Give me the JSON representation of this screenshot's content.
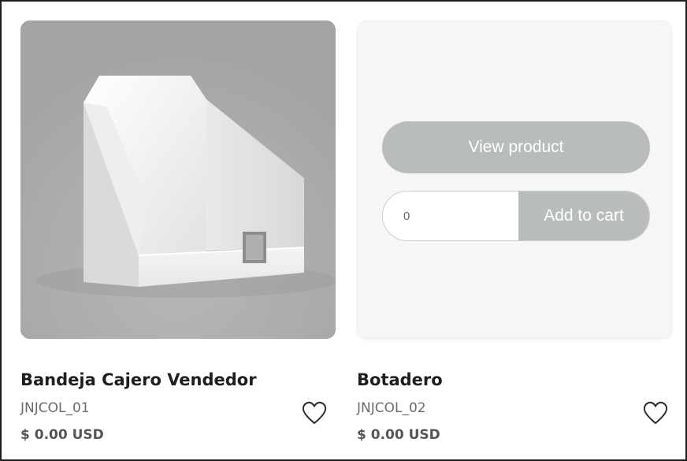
{
  "products": [
    {
      "name": "Bandeja Cajero Vendedor",
      "sku": "JNJCOL_01",
      "price": "$ 0.00 USD",
      "image_icon": "cardboard-display-tray-image"
    },
    {
      "name": "Botadero",
      "sku": "JNJCOL_02",
      "price": "$ 0.00 USD",
      "view_label": "View product",
      "qty_value": "0",
      "add_label": "Add to cart"
    }
  ],
  "icons": {
    "favorite": "heart-icon"
  },
  "colors": {
    "button_bg": "#b9bcbd",
    "photo_bg": "#a9a9a9",
    "card_hover_bg": "#f6f6f6",
    "title_text": "#1e1e1e",
    "muted_text": "#6b6b6b"
  }
}
